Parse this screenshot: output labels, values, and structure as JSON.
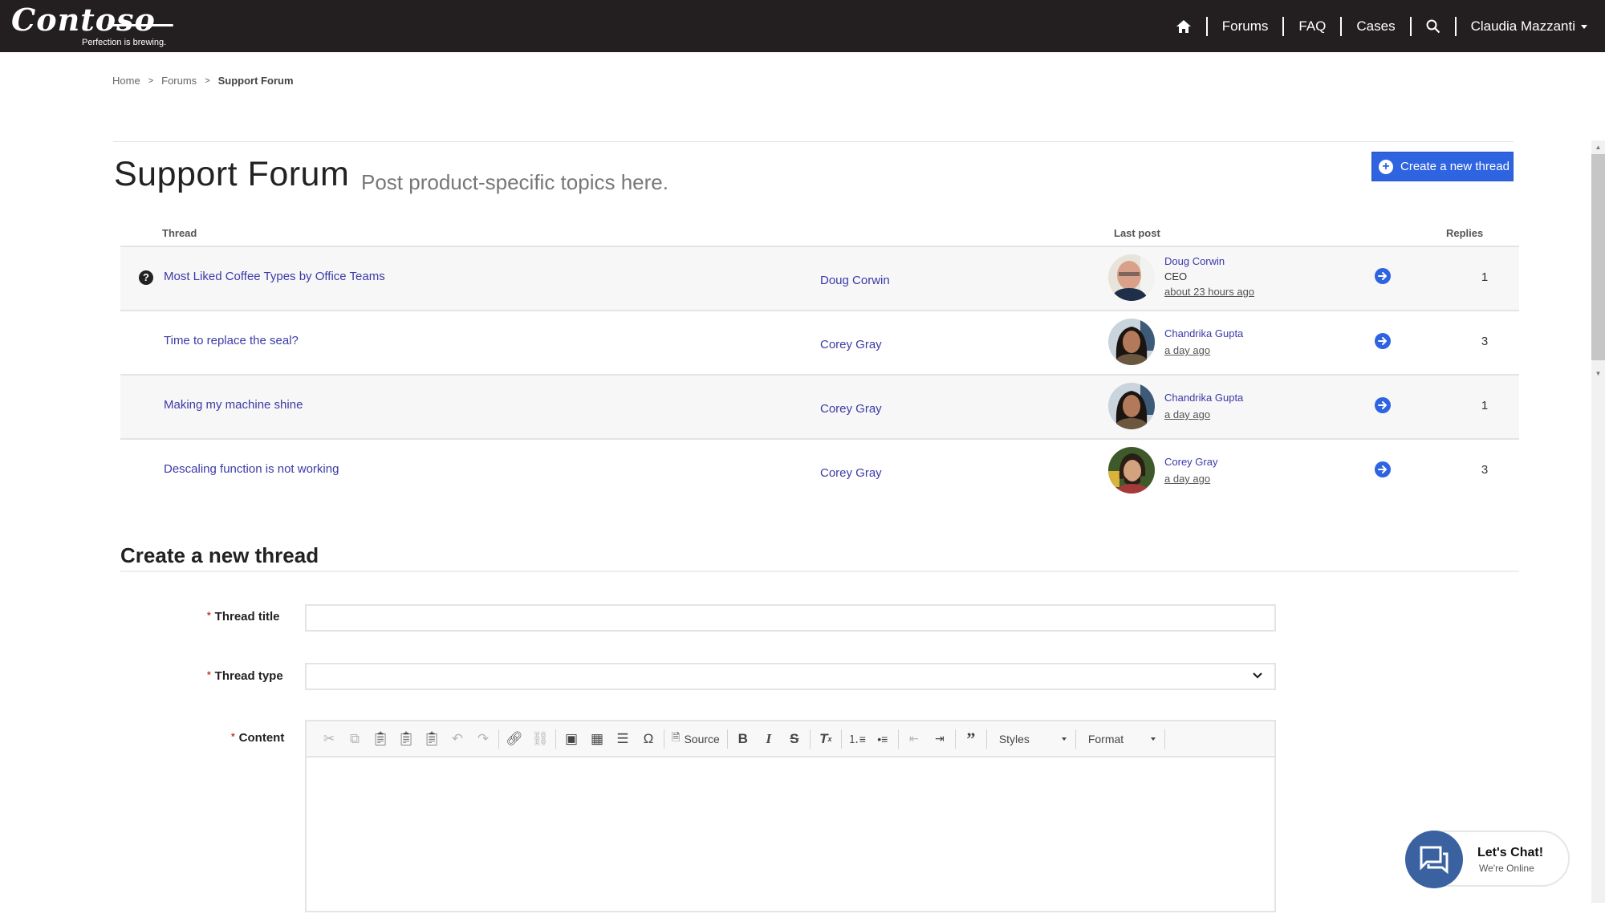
{
  "brand": {
    "name": "Contoso",
    "tagline": "Perfection is brewing."
  },
  "nav": {
    "items": [
      {
        "label": "Forums"
      },
      {
        "label": "FAQ"
      },
      {
        "label": "Cases"
      }
    ],
    "user_name": "Claudia Mazzanti",
    "icons": {
      "home": "home-icon",
      "search": "search-icon",
      "user_menu": "caret-down-icon"
    }
  },
  "breadcrumb": [
    {
      "label": "Home"
    },
    {
      "label": "Forums"
    },
    {
      "label": "Support Forum"
    }
  ],
  "breadcrumb_separator": ">",
  "page": {
    "title": "Support Forum",
    "subtitle": "Post product-specific topics here.",
    "create_button": "Create a new thread"
  },
  "table": {
    "headers": {
      "thread": "Thread",
      "last_post": "Last post",
      "replies": "Replies"
    },
    "rows": [
      {
        "title": "Most Liked Coffee Types by Office Teams",
        "icon": "question-icon",
        "author": "Doug Corwin",
        "last_post_user": "Doug Corwin",
        "last_post_role": "CEO",
        "last_post_time": "about 23 hours ago",
        "replies": "1"
      },
      {
        "title": "Time to replace the seal?",
        "author": "Corey Gray",
        "last_post_user": "Chandrika Gupta",
        "last_post_time": "a day ago",
        "replies": "3"
      },
      {
        "title": "Making my machine shine",
        "author": "Corey Gray",
        "last_post_user": "Chandrika Gupta",
        "last_post_time": "a day ago",
        "replies": "1"
      },
      {
        "title": "Descaling function is not working",
        "author": "Corey Gray",
        "last_post_user": "Corey Gray",
        "last_post_time": "a day ago",
        "replies": "3"
      }
    ]
  },
  "form": {
    "section_title": "Create a new thread",
    "required_marker": "*",
    "fields": {
      "title_label": "Thread title",
      "title_value": "",
      "type_label": "Thread type",
      "type_value": "",
      "content_label": "Content"
    },
    "toolbar": {
      "source_label": "Source",
      "styles_label": "Styles",
      "format_label": "Format"
    }
  },
  "chat": {
    "title": "Let's Chat!",
    "subtitle": "We're Online"
  },
  "colors": {
    "header_bg": "#231f20",
    "accent": "#2f64e0",
    "link": "#3b3aa8",
    "chat": "#3a62a0"
  }
}
